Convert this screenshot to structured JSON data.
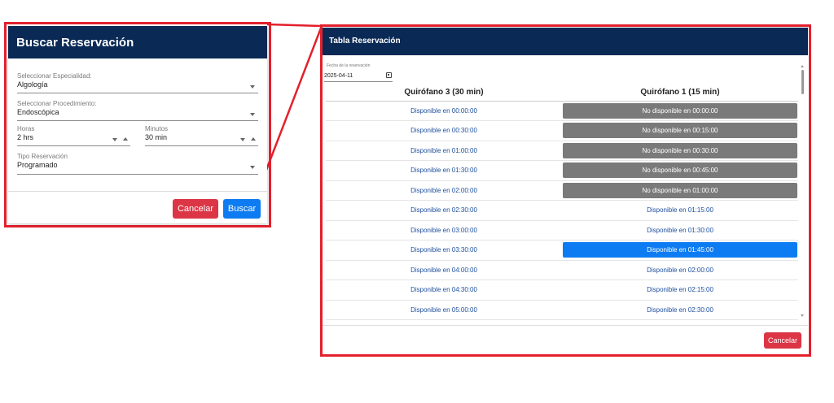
{
  "buscar": {
    "title": "Buscar Reservación",
    "especialidad": {
      "label": "Seleccionar Especialidad:",
      "value": "Algología"
    },
    "procedimiento": {
      "label": "Seleccionar Procedimiento:",
      "value": "Endoscópica"
    },
    "horas": {
      "label": "Horas",
      "value": "2 hrs"
    },
    "minutos": {
      "label": "Minutos",
      "value": "30 min"
    },
    "tipo": {
      "label": "Tipo Reservación",
      "value": "Programado"
    },
    "cancel_label": "Cancelar",
    "search_label": "Buscar"
  },
  "tabla": {
    "title": "Tabla Reservación",
    "date_label": "Fecha de la reservación",
    "date_value": "2025-04-11",
    "columns": [
      "Quirófano 3 (30 min)",
      "Quirófano 1 (15 min)"
    ],
    "rows": [
      {
        "col1": "Disponible en 00:00:00",
        "col2": "No disponible en 00:00:00",
        "col2_state": "unavailable"
      },
      {
        "col1": "Disponible en 00:30:00",
        "col2": "No disponible en 00:15:00",
        "col2_state": "unavailable"
      },
      {
        "col1": "Disponible en 01:00:00",
        "col2": "No disponible en 00:30:00",
        "col2_state": "unavailable"
      },
      {
        "col1": "Disponible en 01:30:00",
        "col2": "No disponible en 00:45:00",
        "col2_state": "unavailable"
      },
      {
        "col1": "Disponible en 02:00:00",
        "col2": "No disponible en 01:00:00",
        "col2_state": "unavailable"
      },
      {
        "col1": "Disponible en 02:30:00",
        "col2": "Disponible en 01:15:00",
        "col2_state": "available"
      },
      {
        "col1": "Disponible en 03:00:00",
        "col2": "Disponible en 01:30:00",
        "col2_state": "available"
      },
      {
        "col1": "Disponible en 03:30:00",
        "col2": "Disponible en 01:45:00",
        "col2_state": "selected"
      },
      {
        "col1": "Disponible en 04:00:00",
        "col2": "Disponible en 02:00:00",
        "col2_state": "available"
      },
      {
        "col1": "Disponible en 04:30:00",
        "col2": "Disponible en 02:15:00",
        "col2_state": "available"
      },
      {
        "col1": "Disponible en 05:00:00",
        "col2": "Disponible en 02:30:00",
        "col2_state": "available"
      }
    ],
    "cancel_label": "Cancelar"
  },
  "colors": {
    "header_bg": "#0a2a55",
    "highlight_border": "#e3202c",
    "cancel": "#dc3545",
    "primary": "#0d7cf2",
    "unavailable": "#7a7a7a",
    "available_text": "#1e4f9e"
  }
}
